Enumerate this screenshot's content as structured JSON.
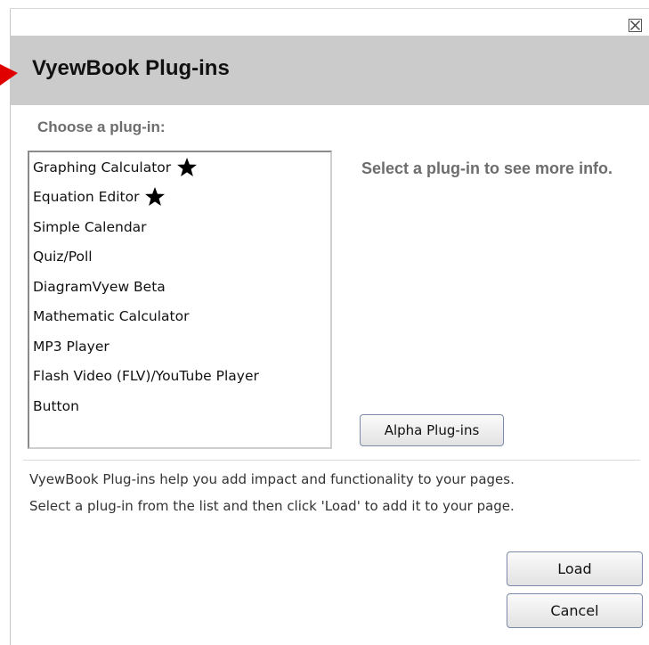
{
  "dialog": {
    "title": "VyewBook Plug-ins",
    "choose_label": "Choose a plug-in:",
    "info_text": "Select a plug-in to see more info.",
    "alpha_button": "Alpha Plug-ins",
    "description_lines": [
      "VyewBook Plug-ins help you add impact and functionality to your pages.",
      "Select a plug-in from the list and then click 'Load' to add it to your page."
    ],
    "load_button": "Load",
    "cancel_button": "Cancel"
  },
  "plugins": [
    {
      "label": "Graphing Calculator",
      "starred": true
    },
    {
      "label": "Equation Editor",
      "starred": true
    },
    {
      "label": "Simple Calendar",
      "starred": false
    },
    {
      "label": "Quiz/Poll",
      "starred": false
    },
    {
      "label": "DiagramVyew Beta",
      "starred": false
    },
    {
      "label": "Mathematic Calculator",
      "starred": false
    },
    {
      "label": "MP3 Player",
      "starred": false
    },
    {
      "label": "Flash Video (FLV)/YouTube Player",
      "starred": false
    },
    {
      "label": "Button",
      "starred": false
    }
  ],
  "icons": {
    "close": "close-icon",
    "star": "star-icon",
    "pointer": "red-arrow-icon"
  },
  "colors": {
    "header_bg": "#cbcbcb",
    "pointer_arrow": "#e00000",
    "secondary_text": "#6d6d6d"
  }
}
